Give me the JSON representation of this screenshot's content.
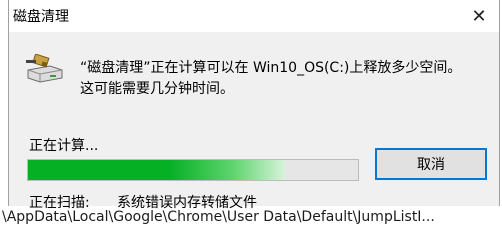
{
  "window": {
    "title": "磁盘清理",
    "close_glyph": "✕"
  },
  "message": {
    "line1": "“磁盘清理”正在计算可以在 Win10_OS(C:)上释放多少空间。",
    "line2": "这可能需要几分钟时间。"
  },
  "status": {
    "label": "正在计算...",
    "progress": 0.78,
    "scan_label": "正在扫描:",
    "scan_item": "系统错误内存转储文件"
  },
  "buttons": {
    "cancel": "取消"
  },
  "background": {
    "path_text": "\\AppData\\Local\\Google\\Chrome\\User Data\\Default\\JumpListI..."
  },
  "colors": {
    "progress_fill": "#06b025",
    "focus_border": "#0078d7"
  },
  "icons": {
    "disk": "disk-cleanup-icon",
    "close": "close-icon"
  }
}
